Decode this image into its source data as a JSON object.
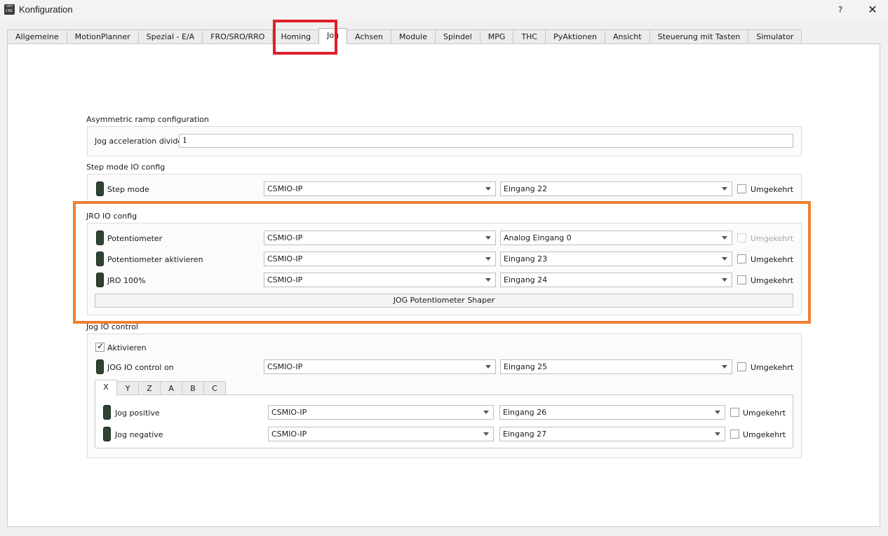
{
  "window": {
    "title": "Konfiguration",
    "help_label": "?",
    "close_label": "✕",
    "icon_text": "sim CNC"
  },
  "tabs": [
    {
      "label": "Allgemeine"
    },
    {
      "label": "MotionPlanner"
    },
    {
      "label": "Spezial - E/A"
    },
    {
      "label": "FRO/SRO/RRO"
    },
    {
      "label": "Homing"
    },
    {
      "label": "Jog"
    },
    {
      "label": "Achsen"
    },
    {
      "label": "Module"
    },
    {
      "label": "Spindel"
    },
    {
      "label": "MPG"
    },
    {
      "label": "THC"
    },
    {
      "label": "PyAktionen"
    },
    {
      "label": "Ansicht"
    },
    {
      "label": "Steuerung mit Tasten"
    },
    {
      "label": "Simulator"
    }
  ],
  "active_tab": "Jog",
  "asym": {
    "title": "Asymmetric ramp configuration",
    "divider_label": "Jog acceleration divider",
    "divider_value": "1"
  },
  "stepmode": {
    "title": "Step mode IO config",
    "row": {
      "label": "Step mode",
      "module": "CSMIO-IP",
      "input": "Eingang 22",
      "invert_label": "Umgekehrt"
    }
  },
  "jro": {
    "title": "JRO IO config",
    "rows": [
      {
        "label": "Potentiometer",
        "module": "CSMIO-IP",
        "input": "Analog Eingang 0",
        "invert_label": "Umgekehrt",
        "invert_enabled": false
      },
      {
        "label": "Potentiometer aktivieren",
        "module": "CSMIO-IP",
        "input": "Eingang 23",
        "invert_label": "Umgekehrt",
        "invert_enabled": true
      },
      {
        "label": "JRO 100%",
        "module": "CSMIO-IP",
        "input": "Eingang 24",
        "invert_label": "Umgekehrt",
        "invert_enabled": true
      }
    ],
    "shaper_button": "JOG Potentiometer Shaper"
  },
  "jogio": {
    "title": "Jog IO control",
    "enable_label": "Aktivieren",
    "enable_checked": true,
    "control_row": {
      "label": "JOG IO control on",
      "module": "CSMIO-IP",
      "input": "Eingang 25",
      "invert_label": "Umgekehrt"
    },
    "axis_tabs": [
      "X",
      "Y",
      "Z",
      "A",
      "B",
      "C"
    ],
    "active_axis": "X",
    "axis_rows": [
      {
        "label": "Jog positive",
        "module": "CSMIO-IP",
        "input": "Eingang 26",
        "invert_label": "Umgekehrt"
      },
      {
        "label": "Jog negative",
        "module": "CSMIO-IP",
        "input": "Eingang 27",
        "invert_label": "Umgekehrt"
      }
    ]
  },
  "colors": {
    "highlight_tab": "#e0202a",
    "highlight_group": "#ef8133",
    "led_off": "#2e4332"
  }
}
